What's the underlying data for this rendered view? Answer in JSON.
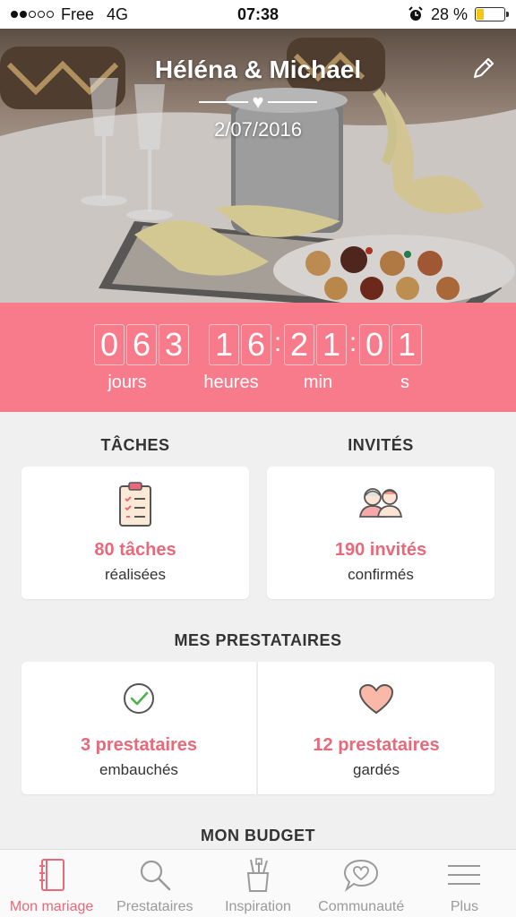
{
  "status_bar": {
    "carrier": "Free",
    "network": "4G",
    "time": "07:38",
    "battery": "28 %",
    "battery_level": 0.28,
    "signal_bars": 2
  },
  "hero": {
    "couple": "Héléna & Michael",
    "date": "2/07/2016",
    "edit_icon": "pencil-icon"
  },
  "countdown": {
    "days": [
      "0",
      "6",
      "3"
    ],
    "hours": [
      "1",
      "6"
    ],
    "minutes": [
      "2",
      "1"
    ],
    "seconds": [
      "0",
      "1"
    ],
    "separator": ":",
    "labels": {
      "days": "jours",
      "hours": "heures",
      "minutes": "min",
      "seconds": "s"
    },
    "background": "#f77b8a"
  },
  "tasks": {
    "title": "TÂCHES",
    "count": "80 tâches",
    "caption": "réalisées",
    "icon": "clipboard-checklist-icon"
  },
  "guests": {
    "title": "INVITÉS",
    "count": "190 invités",
    "caption": "confirmés",
    "icon": "guests-icon"
  },
  "vendors": {
    "title": "MES PRESTATAIRES",
    "hired": {
      "count": "3 prestataires",
      "caption": "embauchés",
      "icon": "check-circle-icon"
    },
    "saved": {
      "count": "12 prestataires",
      "caption": "gardés",
      "icon": "heart-icon"
    }
  },
  "budget": {
    "title": "MON BUDGET"
  },
  "tabbar": {
    "items": [
      {
        "label": "Mon mariage",
        "icon": "notebook-icon",
        "active": true
      },
      {
        "label": "Prestataires",
        "icon": "search-icon",
        "active": false
      },
      {
        "label": "Inspiration",
        "icon": "brush-cup-icon",
        "active": false
      },
      {
        "label": "Communauté",
        "icon": "chat-heart-icon",
        "active": false
      },
      {
        "label": "Plus",
        "icon": "menu-icon",
        "active": false
      }
    ]
  },
  "colors": {
    "accent": "#e8697a",
    "countdown": "#f77b8a",
    "check": "#4caf50",
    "heart": "#f9b8a8"
  }
}
